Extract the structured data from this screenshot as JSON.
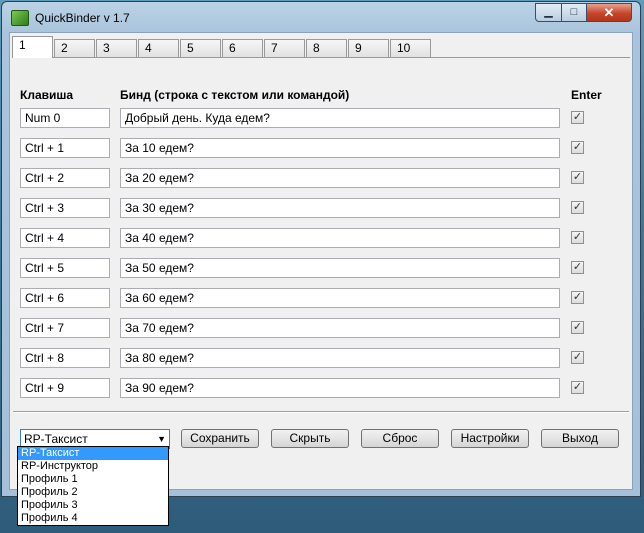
{
  "window": {
    "title": "QuickBinder v 1.7"
  },
  "tabs": [
    "1",
    "2",
    "3",
    "4",
    "5",
    "6",
    "7",
    "8",
    "9",
    "10"
  ],
  "headers": {
    "key": "Клавиша",
    "bind": "Бинд (строка с текстом или командой)",
    "enter": "Enter"
  },
  "rows": [
    {
      "key": "Num 0",
      "bind": "Добрый день. Куда едем?",
      "enter": true
    },
    {
      "key": "Ctrl + 1",
      "bind": "За 10 едем?",
      "enter": true
    },
    {
      "key": "Ctrl + 2",
      "bind": "За 20 едем?",
      "enter": true
    },
    {
      "key": "Ctrl + 3",
      "bind": "За 30 едем?",
      "enter": true
    },
    {
      "key": "Ctrl + 4",
      "bind": "За 40 едем?",
      "enter": true
    },
    {
      "key": "Ctrl + 5",
      "bind": "За 50 едем?",
      "enter": true
    },
    {
      "key": "Ctrl + 6",
      "bind": "За 60 едем?",
      "enter": true
    },
    {
      "key": "Ctrl + 7",
      "bind": "За 70 едем?",
      "enter": true
    },
    {
      "key": "Ctrl + 8",
      "bind": "За 80 едем?",
      "enter": true
    },
    {
      "key": "Ctrl + 9",
      "bind": "За 90 едем?",
      "enter": true
    }
  ],
  "profile": {
    "selected": "RP-Таксист",
    "options": [
      "RP-Таксист",
      "RP-Инструктор",
      "Профиль 1",
      "Профиль 2",
      "Профиль 3",
      "Профиль 4"
    ]
  },
  "buttons": {
    "save": "Сохранить",
    "hide": "Скрыть",
    "reset": "Сброс",
    "settings": "Настройки",
    "exit": "Выход"
  }
}
